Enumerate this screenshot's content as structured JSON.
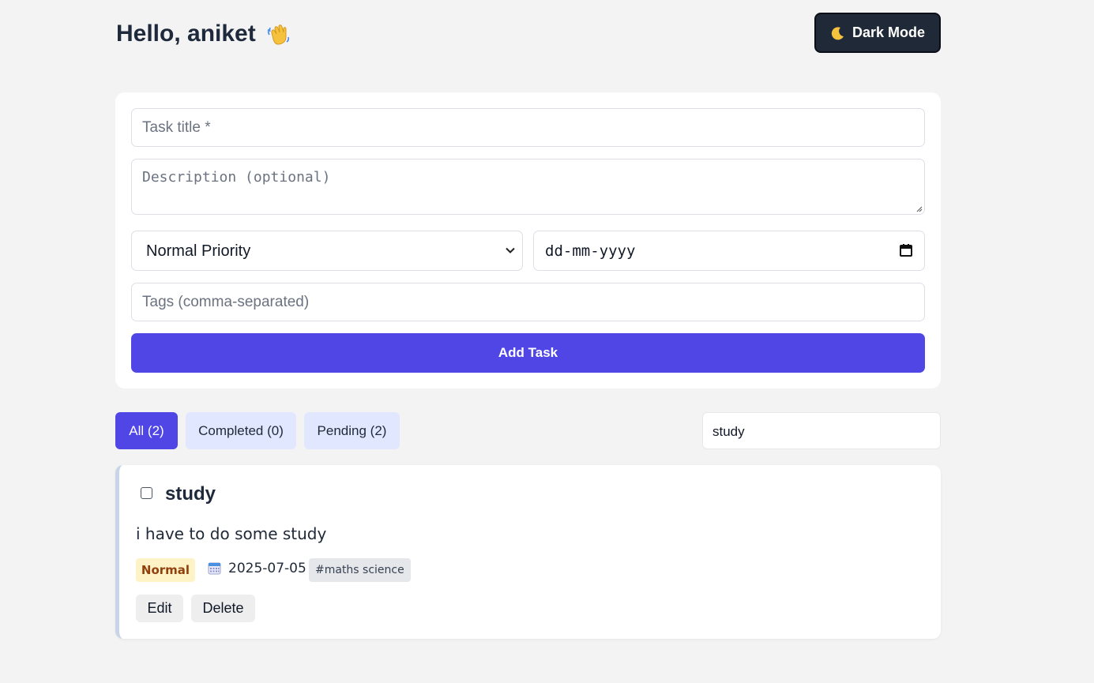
{
  "header": {
    "greeting": "Hello, aniket",
    "greeting_icon": "waving-hand-icon",
    "dark_mode_label": "Dark Mode",
    "dark_mode_icon": "moon-icon"
  },
  "form": {
    "title_placeholder": "Task title *",
    "description_placeholder": "Description (optional)",
    "priority_selected": "Normal Priority",
    "date_placeholder": "dd-mm-yyyy",
    "tags_placeholder": "Tags (comma-separated)",
    "add_button_label": "Add Task"
  },
  "filters": {
    "all_label": "All (2)",
    "completed_label": "Completed (0)",
    "pending_label": "Pending (2)",
    "active": "All (2)"
  },
  "search": {
    "value": "study"
  },
  "tasks": [
    {
      "title": "study",
      "description": "i have to do some study",
      "priority": "Normal",
      "due_date": "2025-07-05",
      "tags": "#maths science",
      "completed": false,
      "edit_label": "Edit",
      "delete_label": "Delete"
    }
  ],
  "colors": {
    "accent": "#4f46e5",
    "filter_inactive": "#e0e7ff",
    "priority_normal_bg": "#fef3c7",
    "priority_normal_text": "#92400e",
    "dark_button": "#1f2937"
  }
}
